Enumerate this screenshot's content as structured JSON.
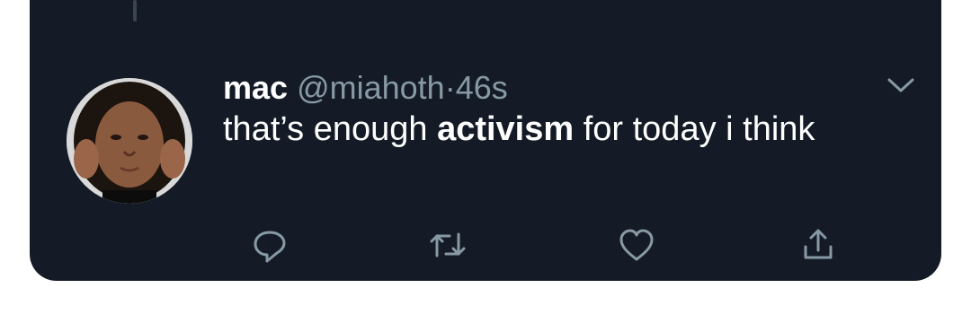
{
  "tweet": {
    "name": "mac",
    "handle": "@miahoth",
    "separator": "·",
    "time": "46s",
    "text_before": "that’s enough ",
    "text_bold": "activism",
    "text_after": " for today i think"
  },
  "icons": {
    "options": "chevron-down-icon",
    "reply": "reply-icon",
    "retweet": "retweet-icon",
    "like": "heart-icon",
    "share": "share-icon"
  },
  "colors": {
    "card_background": "#141b26",
    "page_background": "#ffffff",
    "text_primary": "#ffffff",
    "text_secondary": "#8899a6"
  }
}
